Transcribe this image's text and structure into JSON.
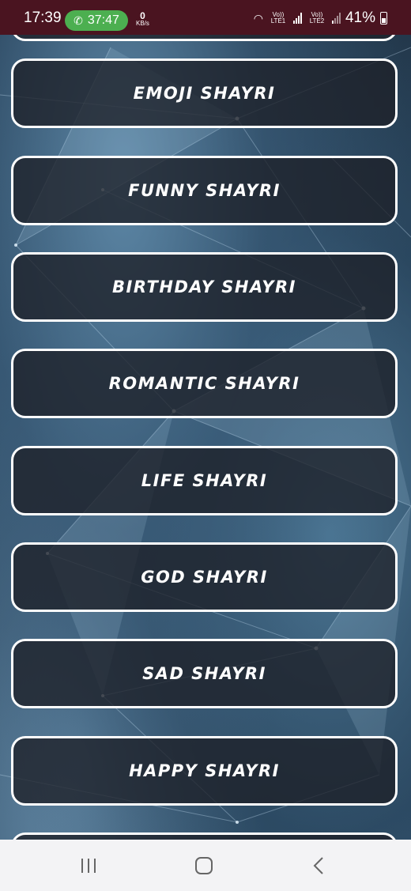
{
  "status_bar": {
    "time": "17:39",
    "call_duration": "37:47",
    "data_speed_value": "0",
    "data_speed_unit": "KB/s",
    "sim1_label": "Vo)) LTE1",
    "sim2_label": "Vo)) LTE2",
    "battery": "41%"
  },
  "categories": [
    {
      "label": "EMOJI SHAYRI"
    },
    {
      "label": "FUNNY SHAYRI"
    },
    {
      "label": "BIRTHDAY SHAYRI"
    },
    {
      "label": "ROMANTIC SHAYRI"
    },
    {
      "label": "LIFE SHAYRI"
    },
    {
      "label": "GOD SHAYRI"
    },
    {
      "label": "SAD SHAYRI"
    },
    {
      "label": "HAPPY SHAYRI"
    }
  ],
  "nav_bar": {
    "icons": [
      "recents-icon",
      "home-icon",
      "back-icon"
    ]
  }
}
